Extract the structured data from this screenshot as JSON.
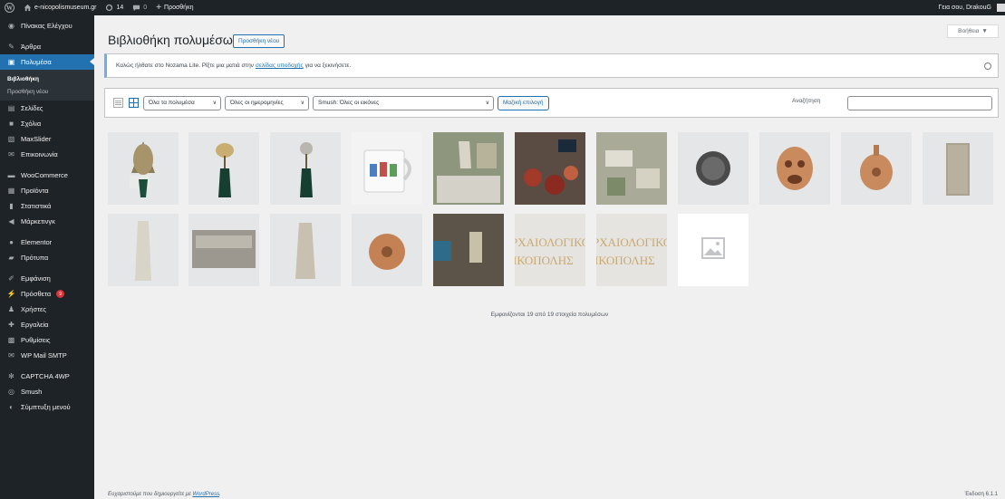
{
  "adminbar": {
    "site_name": "e-nicopolismuseum.gr",
    "updates_count": "14",
    "comments_count": "0",
    "new_label": "Προσθήκη",
    "greeting": "Γεια σου, DrakouG"
  },
  "sidebar": {
    "items": [
      {
        "label": "Πίνακας Ελέγχου",
        "icon": "dashboard-icon"
      },
      {
        "label": "Άρθρα",
        "icon": "pin-icon"
      },
      {
        "label": "Πολυμέσα",
        "icon": "media-icon"
      },
      {
        "label": "Σελίδες",
        "icon": "page-icon"
      },
      {
        "label": "Σχόλια",
        "icon": "comment-icon"
      },
      {
        "label": "MaxSlider",
        "icon": "slider-icon"
      },
      {
        "label": "Επικοινωνία",
        "icon": "mail-icon"
      },
      {
        "label": "WooCommerce",
        "icon": "woo-icon"
      },
      {
        "label": "Προϊόντα",
        "icon": "product-icon"
      },
      {
        "label": "Στατιστικά",
        "icon": "stats-icon"
      },
      {
        "label": "Μάρκετινγκ",
        "icon": "megaphone-icon"
      },
      {
        "label": "Elementor",
        "icon": "elementor-icon"
      },
      {
        "label": "Πρότυπα",
        "icon": "folder-icon"
      },
      {
        "label": "Εμφάνιση",
        "icon": "brush-icon"
      },
      {
        "label": "Πρόσθετα",
        "icon": "plugin-icon",
        "badge": "9"
      },
      {
        "label": "Χρήστες",
        "icon": "users-icon"
      },
      {
        "label": "Εργαλεία",
        "icon": "tools-icon"
      },
      {
        "label": "Ρυθμίσεις",
        "icon": "settings-icon"
      },
      {
        "label": "WP Mail SMTP",
        "icon": "mail-smtp-icon"
      },
      {
        "label": "CAPTCHA 4WP",
        "icon": "captcha-icon"
      },
      {
        "label": "Smush",
        "icon": "smush-icon"
      },
      {
        "label": "Σύμπτυξη μενού",
        "icon": "collapse-icon"
      }
    ],
    "submenu": {
      "library": "Βιβλιοθήκη",
      "add_new": "Προσθήκη νέου"
    }
  },
  "header": {
    "title": "Βιβλιοθήκη πολυμέσων",
    "add_new_label": "Προσθήκη νέου",
    "help_label": "Βοήθεια"
  },
  "notice": {
    "before_link": "Καλώς ήλθατε στο Nozama Lite. Ρίξτε μια ματιά στην",
    "link_text": "σελίδας υποδοχής",
    "after_link": "για να ξεκινήσετε."
  },
  "toolbar": {
    "filter_type": "Όλα τα πολυμέσα",
    "filter_date": "Όλες οι ημερομηνίες",
    "filter_smush": "Smush: Όλες οι εικόνες",
    "bulk_select_label": "Μαζική επιλογή",
    "search_label": "Αναζήτηση",
    "search_value": ""
  },
  "grid": {
    "placeholder_text": "ΑΡΧΑΙΟΛΟΓΙΚΟ ΜΟΥΣΕΙΟ ΝΙΚΟΠΟΛΗΣ",
    "banner_line1": "ΡΧΑΙΟΛΟΓΙΚΟ",
    "banner_line2": "ΙΚΟΠΟΛΗΣ",
    "count_text": "Εμφανίζονται 19 από 19 στοιχεία πολυμέσων"
  },
  "footer": {
    "thanks_before": "Ευχαριστούμε που δημιουργείτε με",
    "thanks_link": "WordPress",
    "version": "Έκδοση 6.1.1"
  },
  "colors": {
    "admin_dark": "#1d2327",
    "accent_blue": "#2271b1",
    "notice_border": "#72aee6",
    "badge_red": "#d63638",
    "banner_gold": "#c9a96e"
  }
}
